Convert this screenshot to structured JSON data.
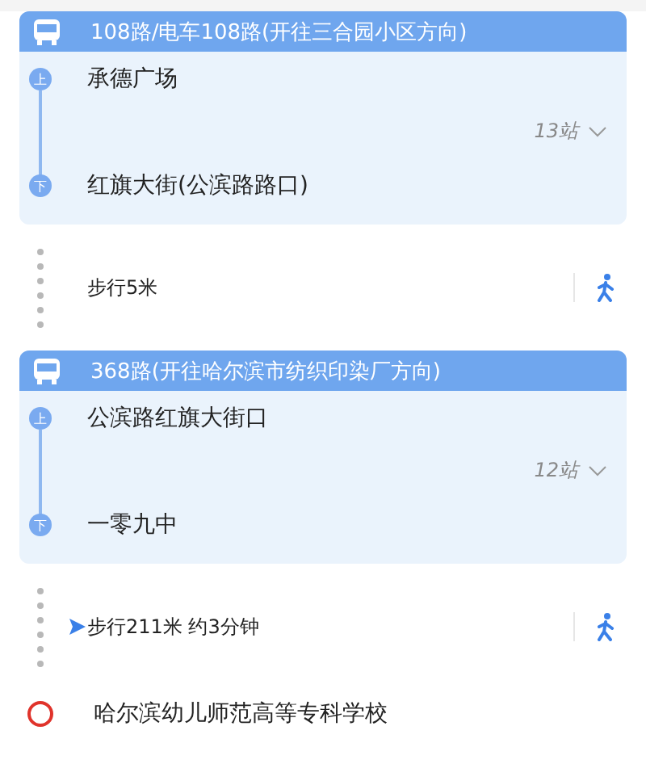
{
  "segments": [
    {
      "kind": "bus",
      "title": "108路/电车108路(开往三合园小区方向)",
      "board": "承德广场",
      "board_badge": "上",
      "stops": "13站",
      "alight": "红旗大街(公滨路路口)",
      "alight_badge": "下"
    },
    {
      "kind": "walk",
      "text": "步行5米",
      "current": false
    },
    {
      "kind": "bus",
      "title": "368路(开往哈尔滨市纺织印染厂方向)",
      "board": "公滨路红旗大街口",
      "board_badge": "上",
      "stops": "12站",
      "alight": "一零九中",
      "alight_badge": "下"
    },
    {
      "kind": "walk",
      "text": "步行211米 约3分钟",
      "current": true
    },
    {
      "kind": "destination",
      "text": "哈尔滨幼儿师范高等专科学校"
    }
  ]
}
